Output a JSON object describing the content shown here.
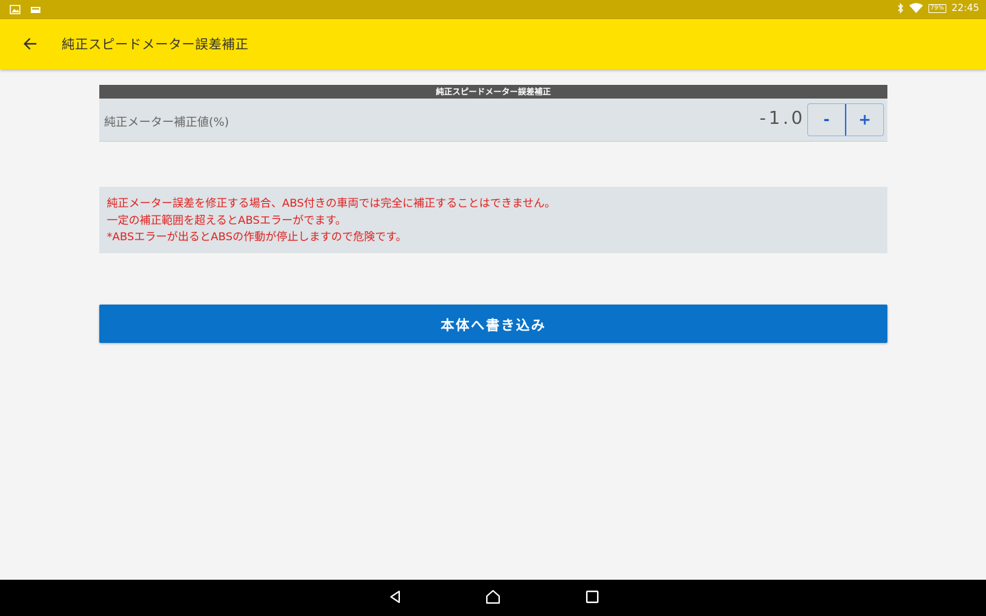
{
  "status_bar": {
    "time": "22:45",
    "battery": "79%",
    "background": "#c8aa00"
  },
  "app_bar": {
    "title": "純正スピードメーター誤差補正",
    "back_icon": "arrow-left-icon",
    "background": "#ffe100"
  },
  "section": {
    "header": "純正スピードメーター誤差補正"
  },
  "setting": {
    "label": "純正メーター補正値(%)",
    "value": "-1.0",
    "decrement_label": "-",
    "increment_label": "+"
  },
  "warning": {
    "lines": [
      "純正メーター誤差を修正する場合、ABS付きの車両では完全に補正することはできません。",
      "一定の補正範囲を超えるとABSエラーがでます。",
      "*ABSエラーが出るとABSの作動が停止しますので危険です。"
    ],
    "color": "#e02020"
  },
  "write_button": {
    "label": "本体へ書き込み",
    "background": "#0a72c8"
  },
  "nav_bar": {
    "icons": [
      "back-triangle-icon",
      "home-icon",
      "recents-square-icon"
    ]
  }
}
